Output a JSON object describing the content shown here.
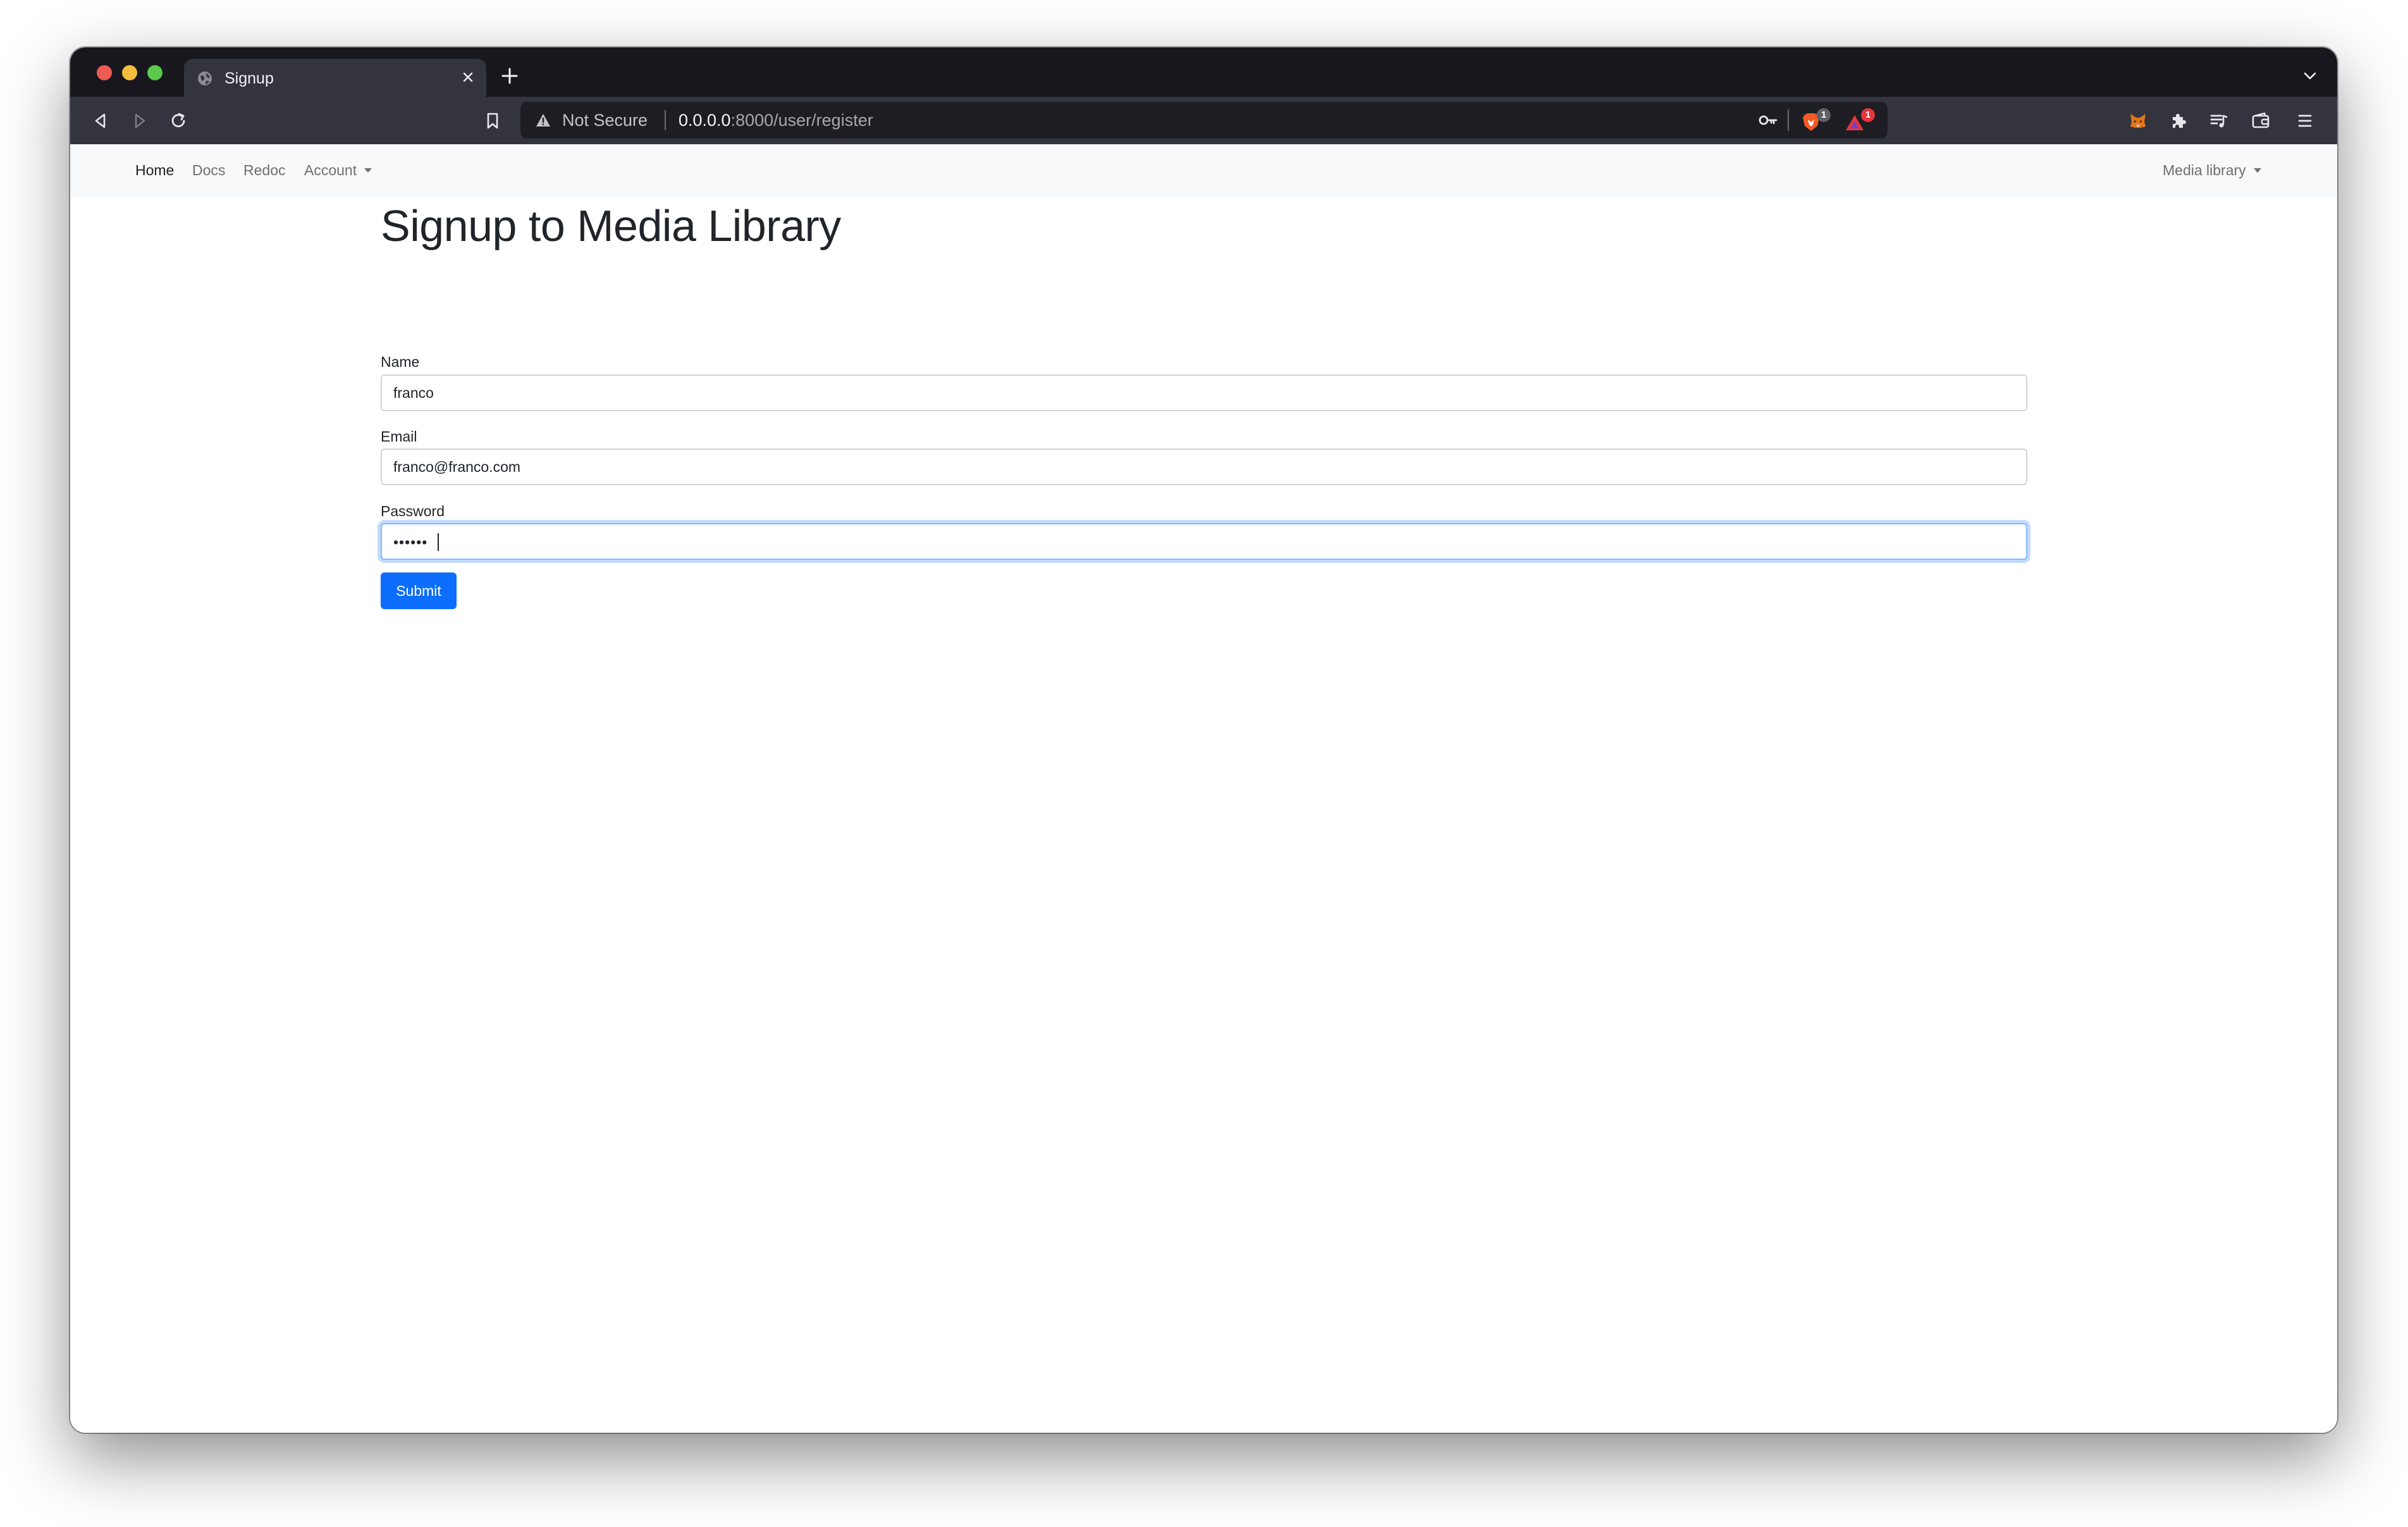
{
  "browser": {
    "tab": {
      "title": "Signup",
      "icon": "globe-icon"
    },
    "address_bar": {
      "security_label": "Not Secure",
      "host": "0.0.0.0",
      "path": ":8000/user/register"
    },
    "extension_badges": {
      "brave_shields_count": "1",
      "rewards_count": "1"
    },
    "colors": {
      "tabstrip": "#17171d",
      "toolbar": "#34343e",
      "shield_badge": "#5f5f68",
      "rewards_badge": "#e6353b"
    }
  },
  "navbar": {
    "links": [
      {
        "label": "Home"
      },
      {
        "label": "Docs"
      },
      {
        "label": "Redoc"
      },
      {
        "label": "Account"
      }
    ],
    "right_dropdown": {
      "label": "Media library"
    }
  },
  "form": {
    "title": "Signup to Media Library",
    "name": {
      "label": "Name",
      "value": "franco"
    },
    "email": {
      "label": "Email",
      "value": "franco@franco.com"
    },
    "password": {
      "label": "Password",
      "masked_value": "••••••"
    },
    "submit_label": "Submit",
    "accent_color": "#0d6efd"
  }
}
